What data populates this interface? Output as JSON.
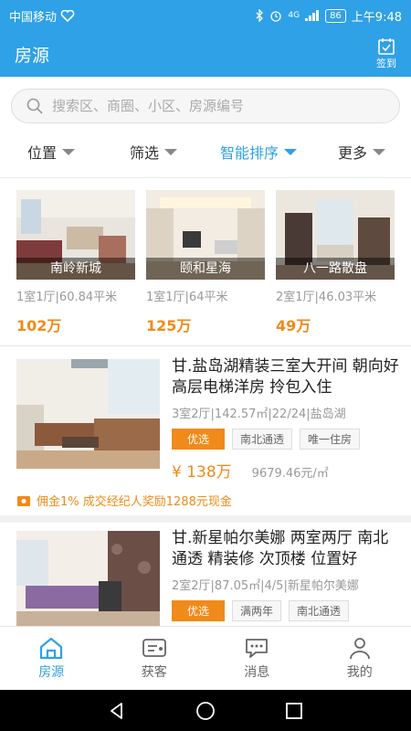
{
  "status_bar": {
    "carrier": "中国移动",
    "network": "4G",
    "battery": "86",
    "time": "上午9:48"
  },
  "header": {
    "title": "房源",
    "checkin_label": "签到"
  },
  "search": {
    "placeholder": "搜索区、商圈、小区、房源编号"
  },
  "filters": [
    {
      "label": "位置",
      "active": false
    },
    {
      "label": "筛选",
      "active": false
    },
    {
      "label": "智能排序",
      "active": true
    },
    {
      "label": "更多",
      "active": false
    }
  ],
  "featured": [
    {
      "name": "南岭新城",
      "meta": "1室1厅|60.84平米",
      "price": "102万"
    },
    {
      "name": "颐和星海",
      "meta": "1室1厅|64平米",
      "price": "125万"
    },
    {
      "name": "八一路散盘",
      "meta": "2室1厅|46.03平米",
      "price": "49万"
    }
  ],
  "listings": [
    {
      "title": "甘.盐岛湖精装三室大开间 朝向好 高层电梯洋房 拎包入住",
      "meta": "3室2厅|142.57㎡|22/24|盐岛湖",
      "tags": [
        "优选",
        "南北通透",
        "唯一住房"
      ],
      "price": "¥ 138万",
      "unit_price": "9679.46元/㎡",
      "commission": "佣金1%  成交经纪人奖励1288元现金"
    },
    {
      "title": "甘.新星帕尔美娜 两室两厅 南北通透 精装修 次顶楼 位置好",
      "meta": "2室2厅|87.05㎡|4/5|新星帕尔美娜",
      "tags": [
        "优选",
        "满两年",
        "南北通透"
      ]
    }
  ],
  "bottom_nav": [
    {
      "label": "房源",
      "icon": "home-icon",
      "active": true
    },
    {
      "label": "获客",
      "icon": "card-icon",
      "active": false
    },
    {
      "label": "消息",
      "icon": "chat-icon",
      "active": false
    },
    {
      "label": "我的",
      "icon": "person-icon",
      "active": false
    }
  ],
  "colors": {
    "primary": "#2fa1e6",
    "accent": "#f08a1a"
  }
}
